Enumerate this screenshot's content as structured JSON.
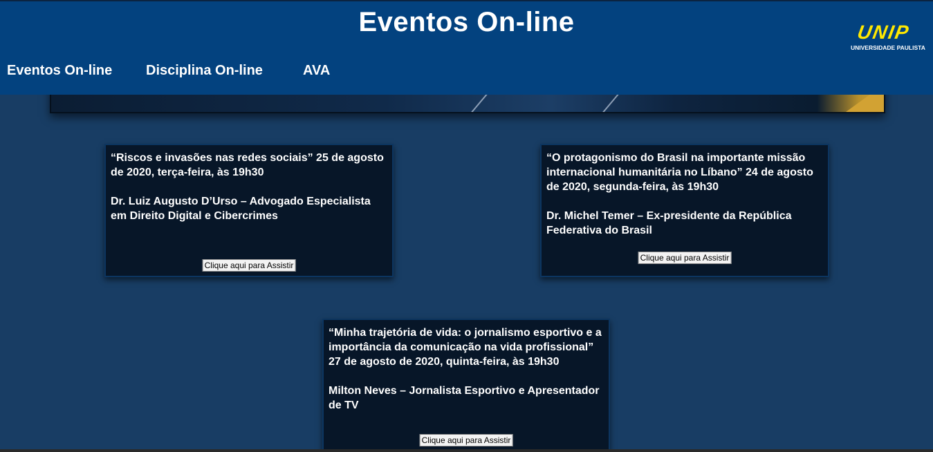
{
  "header": {
    "title": "Eventos On-line",
    "nav": [
      "Eventos On-line",
      "Disciplina On-line",
      "AVA"
    ],
    "logo": {
      "mark": "UNIP",
      "subtitle": "UNIVERSIDADE PAULISTA"
    }
  },
  "colors": {
    "header_bg": "#03427f",
    "page_bg": "#183d64",
    "card_bg": "#071628",
    "logo_yellow": "#ffe800"
  },
  "events": [
    {
      "title": "“Riscos e invasões nas redes sociais” 25 de agosto de 2020, terça-feira, às 19h30",
      "speaker": "Dr. Luiz Augusto D’Urso – Advogado Especialista em Direito Digital e Cibercrimes",
      "button": "Clique aqui para Assistir"
    },
    {
      "title": "“O protagonismo do Brasil na importante missão internacional humanitária no Líbano” 24 de agosto de 2020, segunda-feira, às 19h30",
      "speaker": "Dr. Michel Temer – Ex-presidente da República Federativa do Brasil",
      "button": "Clique aqui para Assistir"
    },
    {
      "title": "“Minha trajetória de vida: o jornalismo esportivo e a importância da comunicação na vida profissional” 27 de agosto de 2020, quinta-feira, às 19h30",
      "speaker": "Milton Neves – Jornalista Esportivo e Apresentador de TV",
      "button": "Clique aqui para Assistir"
    }
  ]
}
